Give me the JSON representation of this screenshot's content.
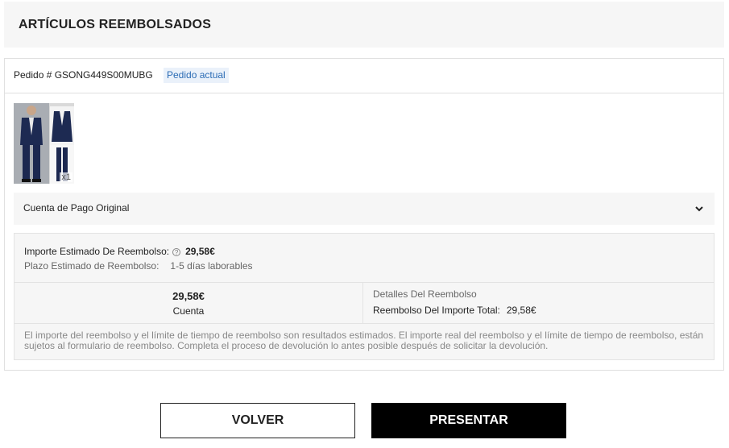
{
  "header": {
    "title": "ARTÍCULOS REEMBOLSADOS"
  },
  "order": {
    "label": "Pedido # GSONG449S00MUBG",
    "badge": "Pedido actual",
    "item_quantity": "x1"
  },
  "payment": {
    "label": "Cuenta de Pago Original",
    "icon": "chevron-down-icon"
  },
  "refund": {
    "estimated_amount_label": "Importe Estimado De Reembolso:",
    "estimated_amount": "29,58€",
    "estimated_time_label": "Plazo Estimado de Reembolso:",
    "estimated_time": "1-5 días laborables",
    "amount": "29,58€",
    "method": "Cuenta",
    "details_title": "Detalles Del Reembolso",
    "total_label": "Reembolso Del Importe Total:",
    "total_value": "29,58€",
    "disclaimer": "El importe del reembolso y el límite de tiempo de reembolso son resultados estimados. El importe real del reembolso y el límite de tiempo de reembolso, están sujetos al formulario de reembolso. Completa el proceso de devolución lo antes posible después de solicitar la devolución."
  },
  "actions": {
    "back_label": "VOLVER",
    "submit_label": "PRESENTAR"
  },
  "colors": {
    "badge_bg": "#eaf1fa",
    "badge_text": "#2b6cb5",
    "submit_bg": "#000000"
  }
}
